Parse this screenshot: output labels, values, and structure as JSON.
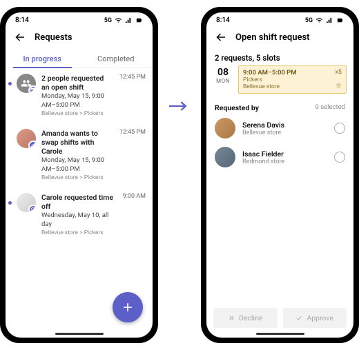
{
  "status": {
    "time": "8:14",
    "network": "5G"
  },
  "left": {
    "title": "Requests",
    "tabs": {
      "in_progress": "In progress",
      "completed": "Completed"
    },
    "items": [
      {
        "title": "2 people requested an open shift",
        "subtitle": "Monday, May 15, 9:00 AM–5:00 PM",
        "meta": "Bellevue store > Pickers",
        "time": "12:45 PM"
      },
      {
        "title": "Amanda wants to swap shifts with Carole",
        "subtitle": "Monday, May 15, 9:00 AM–5:00 PM",
        "meta": "Bellevue store > Pickers",
        "time": "12:45 PM"
      },
      {
        "title": "Carole requested time off",
        "subtitle": "Wednesday, May 10, all day",
        "meta": "Bellevue store > Pickers",
        "time": "9:00 AM"
      }
    ]
  },
  "right": {
    "title": "Open shift request",
    "summary": "2 requests, 5 slots",
    "date": {
      "num": "08",
      "day": "MON"
    },
    "shift": {
      "time": "9:00 AM–5:00 PM",
      "team": "Pickers",
      "store": "Bellevue store",
      "count": "x5"
    },
    "requested_by_label": "Requested by",
    "selected_count": "0 selected",
    "requesters": [
      {
        "name": "Serena Davis",
        "store": "Bellevue store"
      },
      {
        "name": "Isaac Fielder",
        "store": "Redmond store"
      }
    ],
    "decline": "Decline",
    "approve": "Approve"
  }
}
